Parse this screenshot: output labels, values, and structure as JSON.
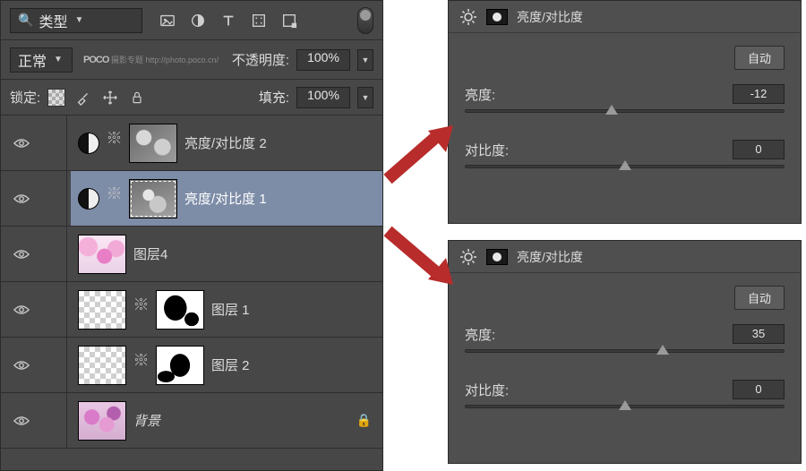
{
  "layers_panel": {
    "search": {
      "mode_label": "类型"
    },
    "blend": {
      "mode_label": "正常",
      "opacity_label": "不透明度:",
      "opacity_value": "100%"
    },
    "lock": {
      "label": "锁定:",
      "fill_label": "填充:",
      "fill_value": "100%"
    },
    "watermark_brand": "POCO",
    "watermark_sub": "摄影专题 http://photo.poco.cn/",
    "layers": [
      {
        "name": "亮度/对比度 2"
      },
      {
        "name": "亮度/对比度 1"
      },
      {
        "name": "图层4"
      },
      {
        "name": "图层 1"
      },
      {
        "name": "图层 2"
      },
      {
        "name": "背景"
      }
    ]
  },
  "adj_top": {
    "title": "亮度/对比度",
    "auto_label": "自动",
    "brightness_label": "亮度:",
    "brightness_value": "-12",
    "contrast_label": "对比度:",
    "contrast_value": "0"
  },
  "adj_bot": {
    "title": "亮度/对比度",
    "auto_label": "自动",
    "brightness_label": "亮度:",
    "brightness_value": "35",
    "contrast_label": "对比度:",
    "contrast_value": "0"
  }
}
